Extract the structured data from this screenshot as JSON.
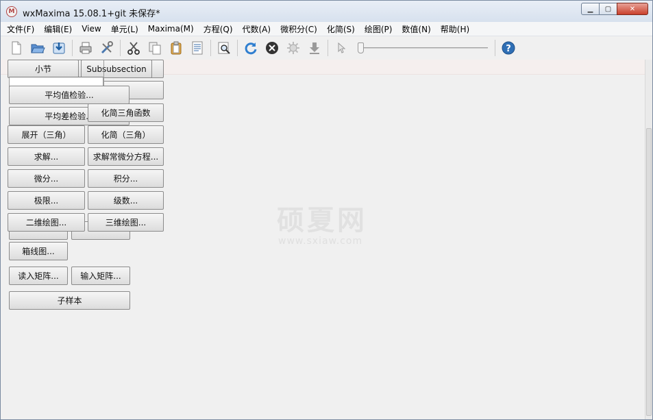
{
  "window": {
    "title": "wxMaxima 15.08.1+git 未保存*",
    "icon_label": "M",
    "buttons": {
      "minimize": "▁",
      "maximize": "▢",
      "close": "✕"
    }
  },
  "menu": [
    "文件(F)",
    "编辑(E)",
    "View",
    "单元(L)",
    "Maxima(M)",
    "方程(Q)",
    "代数(A)",
    "微积分(C)",
    "化简(S)",
    "绘图(P)",
    "数值(N)",
    "帮助(H)"
  ],
  "toolbar": {
    "icons": [
      "new-file-icon",
      "open-folder-icon",
      "save-icon",
      "print-icon",
      "preferences-icon",
      "cut-icon",
      "copy-icon",
      "paste-icon",
      "select-all-icon",
      "find-icon",
      "restart-icon",
      "interrupt-icon",
      "settings-gear-icon",
      "download-icon",
      "cursor-icon",
      "help-icon"
    ],
    "slider_value": 0
  },
  "panel": {
    "section_button": "小节",
    "subsubsection_button": "Subsubsection",
    "mean_test": "平均值检验...",
    "variance_test": "平均差检验...",
    "simplify_trig": "化简三角函数",
    "expand_trig": "展开（三角）",
    "simplify_trig2": "化简（三角）",
    "solve": "求解...",
    "solve_ode": "求解常微分方程...",
    "differentiate": "微分...",
    "integrate": "积分...",
    "limit": "极限...",
    "series": "级数...",
    "plot2d": "二维绘图...",
    "plot3d": "三维绘图...",
    "boxplot": "箱线图...",
    "read_matrix": "读入矩阵...",
    "enter_matrix": "输入矩阵...",
    "subsample": "子样本"
  },
  "watermark": {
    "main": "硕夏网",
    "sub": "www.sxiaw.com"
  },
  "colors": {
    "accent": "#2f6fb5",
    "band": "#f5efee"
  }
}
